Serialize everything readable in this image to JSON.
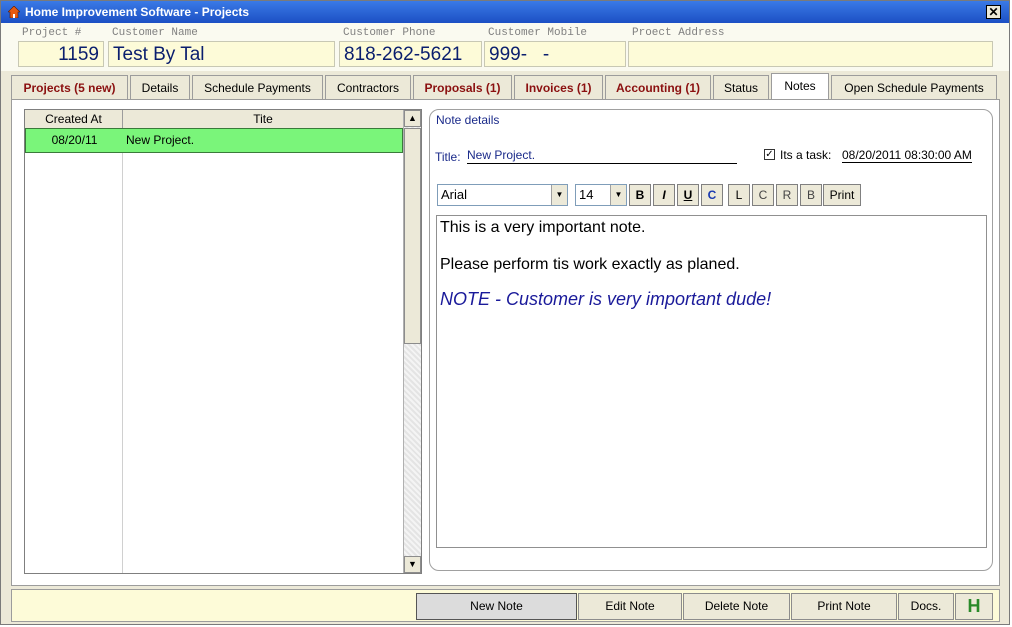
{
  "window": {
    "title": "Home Improvement Software - Projects",
    "close_glyph": "✕"
  },
  "header": {
    "fields": [
      {
        "label": "Project #",
        "value": "1159"
      },
      {
        "label": "Customer Name",
        "value": "Test By Tal"
      },
      {
        "label": "Customer Phone",
        "value": "818-262-5621"
      },
      {
        "label": "Customer Mobile",
        "value": "999-   -"
      },
      {
        "label": "Proect Address",
        "value": ""
      }
    ]
  },
  "tabs": [
    {
      "label": "Projects (5 new)"
    },
    {
      "label": "Details"
    },
    {
      "label": "Schedule Payments"
    },
    {
      "label": "Contractors"
    },
    {
      "label": "Proposals (1)"
    },
    {
      "label": "Invoices (1)"
    },
    {
      "label": "Accounting (1)"
    },
    {
      "label": "Status"
    },
    {
      "label": "Notes"
    },
    {
      "label": "Open Schedule Payments"
    }
  ],
  "notes_list": {
    "columns": [
      "Created At",
      "Tite"
    ],
    "rows": [
      {
        "created_at": "08/20/11",
        "title": "New Project."
      }
    ],
    "scroll_up": "▲",
    "scroll_down": "▼"
  },
  "note_details": {
    "heading": "Note details",
    "title_label": "Title:",
    "title_value": "New Project.",
    "task_checked": "✓",
    "task_label": "Its a task:",
    "task_date": "08/20/2011 08:30:00 AM",
    "font": "Arial",
    "size": "14",
    "format_buttons": [
      "B",
      "I",
      "U",
      "C",
      "L",
      "C",
      "R",
      "B",
      "Print"
    ],
    "dropdown_glyph": "▼",
    "body": [
      "This is a very important note.",
      "Please perform tis work exactly as planed.",
      "NOTE - Customer is very important dude!"
    ]
  },
  "bottom": {
    "buttons": [
      "New Note",
      "Edit Note",
      "Delete Note",
      "Print Note",
      "Docs.",
      "H"
    ]
  },
  "colors": {
    "selected_row": "#7af57a",
    "title_bar": "#1c4fc4",
    "red_tab": "#8b1010"
  }
}
